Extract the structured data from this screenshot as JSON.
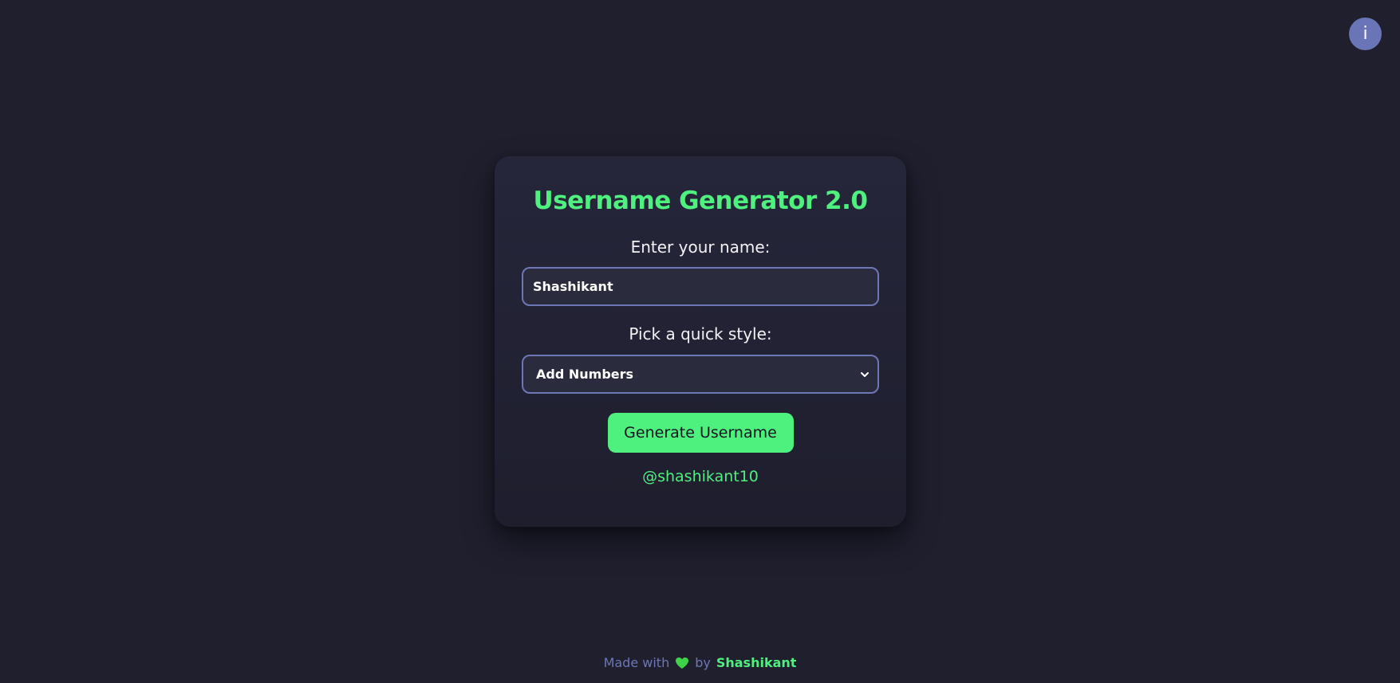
{
  "info_button": {
    "label": "i"
  },
  "card": {
    "title": "Username Generator 2.0",
    "name_label": "Enter your name:",
    "name_value": "Shashikant",
    "style_label": "Pick a quick style:",
    "style_selected": "Add Numbers",
    "generate_label": "Generate Username",
    "result": "@shashikant10"
  },
  "footer": {
    "made_with": "Made with",
    "by": "by",
    "author": "Shashikant",
    "heart_icon": "heart-icon"
  },
  "colors": {
    "background": "#1f1f2e",
    "accent_green": "#4ef07e",
    "border_blue": "#6d77b3",
    "info_button": "#6a75b8"
  }
}
